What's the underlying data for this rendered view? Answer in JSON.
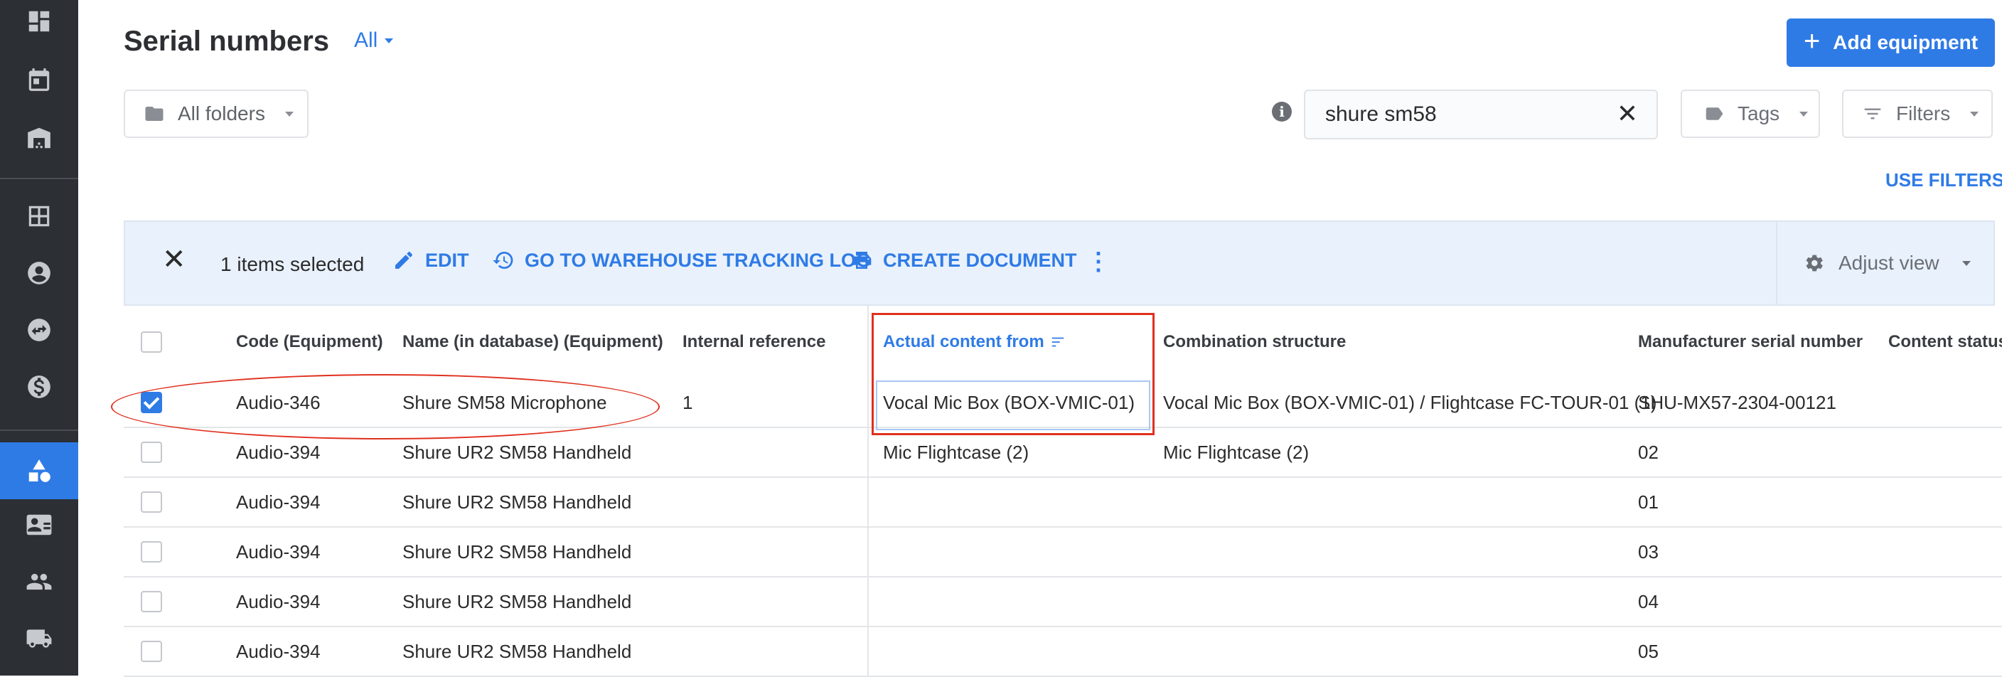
{
  "header": {
    "title": "Serial numbers",
    "view_filter": "All",
    "add_button": "Add equipment"
  },
  "toolbar": {
    "folders": "All folders",
    "search_value": "shure sm58",
    "tags": "Tags",
    "filters": "Filters",
    "use_filters": "USE FILTERS"
  },
  "selection": {
    "count_label": "1 items selected",
    "edit": "EDIT",
    "tracking_log": "GO TO WAREHOUSE TRACKING LOG",
    "create_document": "CREATE DOCUMENT",
    "adjust_view": "Adjust view"
  },
  "table": {
    "columns": [
      "Code (Equipment)",
      "Name (in database) (Equipment)",
      "Internal reference",
      "Actual content from",
      "Combination structure",
      "Manufacturer serial number",
      "Content status"
    ],
    "rows": [
      {
        "checked": true,
        "code": "Audio-346",
        "name": "Shure SM58 Microphone",
        "ref": "1",
        "content": "Vocal Mic Box (BOX-VMIC-01)",
        "combo": "Vocal Mic Box (BOX-VMIC-01) / Flightcase FC-TOUR-01 (1)",
        "serial": "SHU-MX57-2304-00121",
        "status": ""
      },
      {
        "checked": false,
        "code": "Audio-394",
        "name": "Shure UR2 SM58 Handheld",
        "ref": "",
        "content": "Mic Flightcase (2)",
        "combo": "Mic Flightcase (2)",
        "serial": "02",
        "status": ""
      },
      {
        "checked": false,
        "code": "Audio-394",
        "name": "Shure UR2 SM58 Handheld",
        "ref": "",
        "content": "",
        "combo": "",
        "serial": "01",
        "status": ""
      },
      {
        "checked": false,
        "code": "Audio-394",
        "name": "Shure UR2 SM58 Handheld",
        "ref": "",
        "content": "",
        "combo": "",
        "serial": "03",
        "status": ""
      },
      {
        "checked": false,
        "code": "Audio-394",
        "name": "Shure UR2 SM58 Handheld",
        "ref": "",
        "content": "",
        "combo": "",
        "serial": "04",
        "status": ""
      },
      {
        "checked": false,
        "code": "Audio-394",
        "name": "Shure UR2 SM58 Handheld",
        "ref": "",
        "content": "",
        "combo": "",
        "serial": "05",
        "status": ""
      }
    ]
  },
  "sidebar": {
    "items": [
      {
        "icon": "dashboard-icon"
      },
      {
        "icon": "calendar-icon"
      },
      {
        "icon": "warehouse-icon"
      },
      {
        "icon": "table-icon"
      },
      {
        "icon": "account-icon"
      },
      {
        "icon": "transfer-icon"
      },
      {
        "icon": "dollar-icon"
      },
      {
        "icon": "equipment-icon",
        "active": true
      },
      {
        "icon": "contact-card-icon"
      },
      {
        "icon": "people-icon"
      },
      {
        "icon": "truck-icon"
      }
    ]
  },
  "colors": {
    "accent": "#2f7be6",
    "sidebar_bg": "#2c2f33",
    "selection_bg": "#e9f1fc",
    "annotation": "#e0301e"
  }
}
